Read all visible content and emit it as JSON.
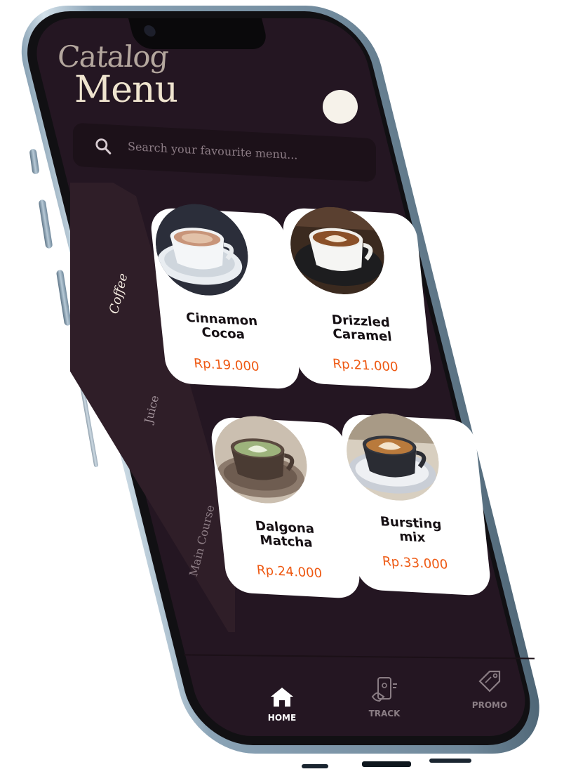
{
  "header": {
    "title_line1": "Catalog",
    "title_line2": "Menu"
  },
  "search": {
    "placeholder": "Search your favourite menu...",
    "icon": "search-icon"
  },
  "categories": [
    {
      "label": "Coffee",
      "active": true
    },
    {
      "label": "Juice",
      "active": false
    },
    {
      "label": "Main Course",
      "active": false
    }
  ],
  "products": [
    {
      "name_line1": "Cinnamon",
      "name_line2": "Cocoa",
      "price": "Rp.19.000"
    },
    {
      "name_line1": "Drizzled",
      "name_line2": "Caramel",
      "price": "Rp.21.000"
    },
    {
      "name_line1": "Dalgona",
      "name_line2": "Matcha",
      "price": "Rp.24.000"
    },
    {
      "name_line1": "Bursting",
      "name_line2": "mix",
      "price": "Rp.33.000"
    }
  ],
  "nav": [
    {
      "label": "HOME",
      "icon": "home-icon",
      "active": true
    },
    {
      "label": "TRACK",
      "icon": "track-phone-icon",
      "active": false
    },
    {
      "label": "PROMO",
      "icon": "promo-tag-icon",
      "active": false
    }
  ],
  "colors": {
    "screen_bg": "#241622",
    "rail_bg": "#2f1e28",
    "price": "#ee5a14",
    "title_primary": "#efe4cf",
    "title_secondary": "#b4a79e"
  }
}
